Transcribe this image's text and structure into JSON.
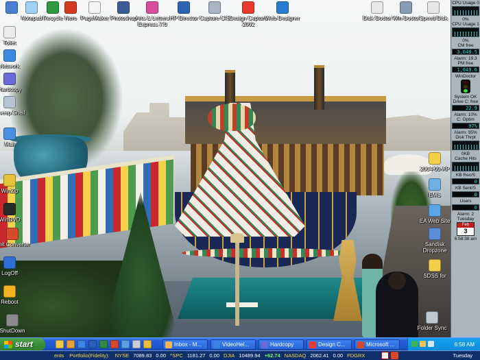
{
  "desktop": {
    "icons": [
      {
        "label": "",
        "icon": "my-computer-icon",
        "color": "#4a7fd1"
      },
      {
        "label": "Notepad",
        "icon": "notepad-icon",
        "color": "#9fd1f2"
      },
      {
        "label": "Recycle",
        "icon": "recycle-bin-icon",
        "color": "#2f9a3f"
      },
      {
        "label": "Nero",
        "icon": "nero-icon",
        "color": "#d63a1e"
      },
      {
        "label": "PageMaker",
        "icon": "pagemaker-icon",
        "color": "#f4f4f4"
      },
      {
        "label": "Photoshop",
        "icon": "photoshop-icon",
        "color": "#3d5b95"
      },
      {
        "label": "Arts & Letters Express 7.0",
        "icon": "arts-letters-icon",
        "color": "#d94e9b"
      },
      {
        "label": "HP Director",
        "icon": "hp-director-icon",
        "color": "#2f63b5"
      },
      {
        "label": "Capture CIS",
        "icon": "capture-cis-icon",
        "color": "#a9b4c4"
      },
      {
        "label": "Design Capture 2002",
        "icon": "design-capture-icon",
        "color": "#e83b2e"
      },
      {
        "label": "Web Designer",
        "icon": "web-designer-icon",
        "color": "#2a7ccf"
      },
      {
        "label": "Disk Doctor",
        "icon": "disk-doctor-icon",
        "color": "#e8e8e8"
      },
      {
        "label": "Win Doctor",
        "icon": "win-doctor-icon",
        "color": "#8a9ab3"
      },
      {
        "label": "Speed Disk",
        "icon": "speed-disk-icon",
        "color": "#e6e6e6"
      },
      {
        "label": "Toilet",
        "icon": "toilet-icon",
        "color": "#ececec"
      },
      {
        "label": "Network",
        "icon": "network-icon",
        "color": "#3d8be0"
      },
      {
        "label": "Hardcopy",
        "icon": "hardcopy-icon",
        "color": "#6b6bd8"
      },
      {
        "label": "Sweep Shell",
        "icon": "sweep-shell-icon",
        "color": "#b7c3d2"
      },
      {
        "label": "Mail",
        "icon": "mail-icon",
        "color": "#4b8fe0"
      },
      {
        "label": "WinZip",
        "icon": "winzip-icon",
        "color": "#e4c23a"
      },
      {
        "label": "WinDVD",
        "icon": "windvd-icon",
        "color": "#2a2a2a"
      },
      {
        "label": "Unit Converter",
        "icon": "unit-converter-icon",
        "color": "#d84b2a"
      },
      {
        "label": "LogOff",
        "icon": "logoff-icon",
        "color": "#2f6fd8"
      },
      {
        "label": "Reboot",
        "icon": "reboot-icon",
        "color": "#f0b322"
      },
      {
        "label": "ShutDown",
        "icon": "shutdown-icon",
        "color": "#8a8a8a"
      },
      {
        "label": "2004-09-AP",
        "icon": "folder-icon",
        "color": "#f2cf4a"
      },
      {
        "label": "EMS",
        "icon": "ems-icon",
        "color": "#6fb0e6"
      },
      {
        "label": "EA Web Site",
        "icon": "ea-web-site-icon",
        "color": "#5aa7e8"
      },
      {
        "label": "Sandisk Dropzone",
        "icon": "sandisk-dropzone-icon",
        "color": "#5b8fd8"
      },
      {
        "label": "SDSS for",
        "icon": "folder-icon",
        "color": "#f2cf4a"
      },
      {
        "label": "Folder Sync",
        "icon": "folder-sync-icon",
        "color": "#bfc9d4"
      }
    ]
  },
  "monitor": {
    "cpu1_label": "CPU Usage 0",
    "cpu1_value": "0%",
    "cpu2_label": "CPU Usage 1",
    "cpu2_value": "0%",
    "ram_label": "CM free",
    "ram_value": "3,649.5",
    "ram_alarm": "Alarm: 19.3",
    "pm_label": "PM free",
    "pm_value": "1,643.6",
    "windoctor_label": "WinDoctor",
    "system_label": "System OK",
    "drive_label": "Drive C: free",
    "drive_value": "22.9",
    "drive_alarm": "Alarm: 10%",
    "optim_label": "C: Optim",
    "optim_value": "97%",
    "optim_alarm": "Alarm: 95%",
    "disk_label": "Disk Thrpt",
    "disk_value": "0KB",
    "cache_label": "Cache Hits",
    "cache_value": "",
    "kbread_label": "KB Rec/S",
    "kbread_value": "0",
    "kbsent_label": "KB Sent/S",
    "kbsent_value": "0",
    "users_label": "Users",
    "users_value": "0",
    "users_alarm": "Alarm: 2",
    "cal_weekday": "Tuesday",
    "cal_month": "Feb",
    "cal_day": "3",
    "cal_time": "6:58:38 am"
  },
  "taskbar": {
    "start_label": "start",
    "quick_launch_icons": [
      {
        "icon": "windows-explorer-icon",
        "color": "#f3c74a"
      },
      {
        "icon": "outlook-icon",
        "color": "#e8a23a"
      },
      {
        "icon": "internet-explorer-icon",
        "color": "#3b83e0"
      },
      {
        "icon": "word-icon",
        "color": "#2b5eb8"
      },
      {
        "icon": "excel-icon",
        "color": "#2f8a3f"
      },
      {
        "icon": "media-icon",
        "color": "#d9482a"
      },
      {
        "icon": "desktop-icon",
        "color": "#5aa1e6"
      },
      {
        "icon": "calc-icon",
        "color": "#c8cfd8"
      },
      {
        "icon": "tool-icon",
        "color": "#e6c13a"
      }
    ],
    "tasks": [
      {
        "label": "Inbox - M...",
        "icon": "outlook-icon",
        "color": "#f0b74a"
      },
      {
        "label": "VideoHel...",
        "icon": "ie-icon",
        "color": "#3b83e0"
      },
      {
        "label": "Hardcopy",
        "icon": "hardcopy-icon",
        "color": "#6b6bd8"
      },
      {
        "label": "Design C...",
        "icon": "design-capture-icon",
        "color": "#e83b2e"
      },
      {
        "label": "Microsoft ...",
        "icon": "microsoft-icon",
        "color": "#d9482a"
      }
    ],
    "clock": "6:58 AM"
  },
  "ticker": {
    "start_label": "ents",
    "portfolio": "Portfolio(Fidelity):",
    "items": [
      {
        "sym": "NYSE",
        "value": "7089.83",
        "change": "0.00"
      },
      {
        "sym": "^SPC",
        "value": "1181.27",
        "change": "0.00"
      },
      {
        "sym": "DJIA",
        "value": "10489.94",
        "change": "+62.74"
      },
      {
        "sym": "NASDAQ",
        "value": "2062.41",
        "change": "0.00"
      },
      {
        "sym": "FDGRX",
        "value": "",
        "change": ""
      }
    ],
    "day": "Tuesday"
  }
}
